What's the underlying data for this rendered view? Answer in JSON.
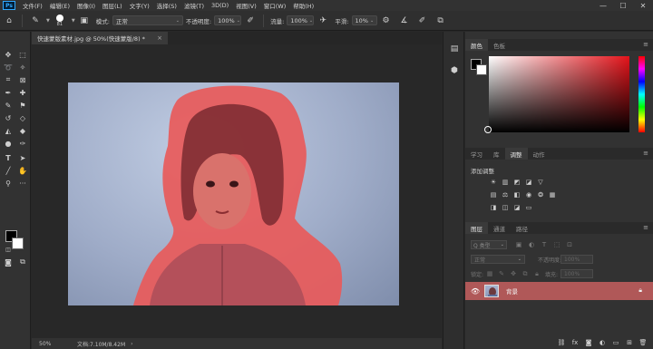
{
  "app": {
    "logo": "Ps"
  },
  "menu": [
    "文件(F)",
    "编辑(E)",
    "图像(I)",
    "图层(L)",
    "文字(Y)",
    "选择(S)",
    "滤镜(T)",
    "3D(D)",
    "视图(V)",
    "窗口(W)",
    "帮助(H)"
  ],
  "window_controls": {
    "minimize": "—",
    "maximize": "☐",
    "close": "✕"
  },
  "options": {
    "brush_size": "81",
    "mode_label": "模式:",
    "mode_value": "正常",
    "opacity_label": "不透明度:",
    "opacity_value": "100%",
    "flow_label": "流量:",
    "flow_value": "100%",
    "smoothing_label": "平滑:",
    "smoothing_value": "10%"
  },
  "document": {
    "tab_title": "快速蒙版素材.jpg @ 50%(快速蒙版/8) *",
    "close": "×",
    "zoom": "50%",
    "info": "文档:7.10M/8.42M",
    "arrow": "›"
  },
  "color_panel": {
    "tabs": [
      "颜色",
      "色板"
    ],
    "active": 0
  },
  "adjust_panel": {
    "tabs": [
      "学习",
      "库",
      "调整",
      "动作"
    ],
    "active": 2,
    "title": "添加调整",
    "row1": [
      "☀",
      "▥",
      "◩",
      "◪",
      "▽"
    ],
    "row2": [
      "▤",
      "⚖",
      "◧",
      "◉",
      "❂",
      "▦"
    ],
    "row3": [
      "◨",
      "◫",
      "◪",
      "▭"
    ]
  },
  "layers_panel": {
    "tabs": [
      "图层",
      "通道",
      "路径"
    ],
    "active": 0,
    "filter_placeholder": "Q 类型",
    "blend_mode": "正常",
    "opacity_label": "不透明度:",
    "opacity_value": "100%",
    "lock_label": "锁定:",
    "fill_label": "填充:",
    "fill_value": "100%",
    "layers": [
      {
        "name": "背景",
        "visible": true,
        "locked": true
      }
    ]
  },
  "colors": {
    "foreground": "#000000",
    "background": "#ffffff",
    "mask_overlay": "#e85a5a",
    "selected_layer": "#b05858",
    "photo_bg": "#9facc8"
  }
}
